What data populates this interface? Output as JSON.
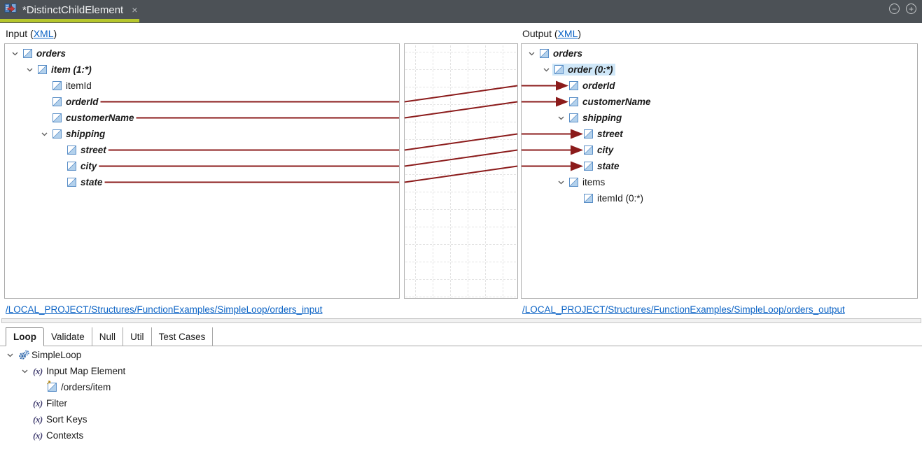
{
  "tab_strip": {
    "title": "*DistinctChildElement",
    "close_label": "×",
    "collapse_icon": "−",
    "expand_icon": "+"
  },
  "headers": {
    "input_prefix": "Input (",
    "input_link": "XML",
    "input_suffix": ")",
    "output_prefix": "Output (",
    "output_link": "XML",
    "output_suffix": ")"
  },
  "left_tree": [
    {
      "depth": 0,
      "label": "orders",
      "chevron": true,
      "mapped": true
    },
    {
      "depth": 1,
      "label": "item (1:*)",
      "chevron": true,
      "mapped": true
    },
    {
      "depth": 2,
      "label": "itemId",
      "mapped": false
    },
    {
      "depth": 2,
      "label": "orderId",
      "mapped": true
    },
    {
      "depth": 2,
      "label": "customerName",
      "mapped": true
    },
    {
      "depth": 2,
      "label": "shipping",
      "chevron": true,
      "mapped": true
    },
    {
      "depth": 3,
      "label": "street",
      "mapped": true
    },
    {
      "depth": 3,
      "label": "city",
      "mapped": true
    },
    {
      "depth": 3,
      "label": "state",
      "mapped": true
    }
  ],
  "right_tree": [
    {
      "depth": 0,
      "label": "orders",
      "chevron": true,
      "mapped": true
    },
    {
      "depth": 1,
      "label": "order (0:*)",
      "chevron": true,
      "mapped": true,
      "selected": true
    },
    {
      "depth": 2,
      "label": "orderId",
      "mapped": true
    },
    {
      "depth": 2,
      "label": "customerName",
      "mapped": true
    },
    {
      "depth": 2,
      "label": "shipping",
      "chevron": true,
      "mapped": true
    },
    {
      "depth": 3,
      "label": "street",
      "mapped": true
    },
    {
      "depth": 3,
      "label": "city",
      "mapped": true
    },
    {
      "depth": 3,
      "label": "state",
      "mapped": true
    },
    {
      "depth": 2,
      "label": "items",
      "chevron": true,
      "mapped": false
    },
    {
      "depth": 3,
      "label": "itemId (0:*)",
      "mapped": false
    }
  ],
  "connections": [
    {
      "from": 3,
      "to": 2
    },
    {
      "from": 4,
      "to": 3
    },
    {
      "from": 6,
      "to": 5
    },
    {
      "from": 7,
      "to": 6
    },
    {
      "from": 8,
      "to": 7
    }
  ],
  "footer_links": {
    "input": "/LOCAL_PROJECT/Structures/FunctionExamples/SimpleLoop/orders_input",
    "output": "/LOCAL_PROJECT/Structures/FunctionExamples/SimpleLoop/orders_output"
  },
  "bottom_panel": {
    "tabs": [
      {
        "label": "Loop",
        "active": true
      },
      {
        "label": "Validate",
        "active": false
      },
      {
        "label": "Null",
        "active": false
      },
      {
        "label": "Util",
        "active": false
      },
      {
        "label": "Test Cases",
        "active": false
      }
    ],
    "tree": [
      {
        "depth": 0,
        "label": "SimpleLoop",
        "chevron": true,
        "icon": "gears"
      },
      {
        "depth": 1,
        "label": "Input Map Element",
        "chevron": true,
        "icon": "fx"
      },
      {
        "depth": 2,
        "label": "/orders/item",
        "icon": "element-ref"
      },
      {
        "depth": 1,
        "label": "Filter",
        "icon": "fx"
      },
      {
        "depth": 1,
        "label": "Sort Keys",
        "icon": "fx"
      },
      {
        "depth": 1,
        "label": "Contexts",
        "icon": "fx"
      }
    ]
  },
  "colors": {
    "accent_underline": "#b6c62c",
    "map_line": "#8b1b1b",
    "link": "#0b63c5",
    "selection": "#cfe7f8"
  }
}
